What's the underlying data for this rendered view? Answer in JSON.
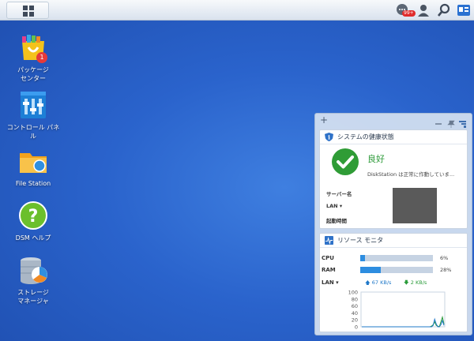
{
  "topbar": {
    "main_menu_icon": "grid-icon",
    "notification_badge": "99+",
    "icons": [
      "chat-icon",
      "user-icon",
      "search-icon",
      "widget-icon"
    ]
  },
  "desktop": {
    "icons": [
      {
        "label": "パッケージ\nセンター",
        "icon": "package-center-icon",
        "badge": "1"
      },
      {
        "label": "コントロール パネル",
        "icon": "control-panel-icon"
      },
      {
        "label": "File Station",
        "icon": "file-station-icon"
      },
      {
        "label": "DSM ヘルプ",
        "icon": "help-icon"
      },
      {
        "label": "ストレージ\nマネージャ",
        "icon": "storage-manager-icon"
      }
    ]
  },
  "widgets": {
    "add_label": "+",
    "health": {
      "title": "システムの健康状態",
      "status": "良好",
      "description": "DiskStation は正常に作動していま...",
      "rows": [
        "サーバー名",
        "LAN ▾",
        "起動時間"
      ]
    },
    "resource": {
      "title": "リソース モニタ",
      "cpu": {
        "label": "CPU",
        "value": 6,
        "text": "6%"
      },
      "ram": {
        "label": "RAM",
        "value": 28,
        "text": "28%"
      },
      "lan": {
        "label": "LAN ▾",
        "up": "67 KB/s",
        "down": "2 KB/s"
      }
    }
  },
  "chart_data": {
    "type": "line",
    "ylim": [
      0,
      100
    ],
    "yticks": [
      "100",
      "80",
      "60",
      "40",
      "20",
      "0"
    ],
    "series": [
      {
        "values": [
          0,
          0,
          0,
          0,
          0,
          0,
          0,
          0,
          0,
          0,
          0,
          0,
          0,
          0,
          0,
          0,
          0,
          0,
          0,
          0,
          0,
          0,
          0,
          0,
          0,
          0,
          0,
          0,
          0,
          0,
          0,
          0,
          0,
          0,
          0,
          0,
          0,
          0,
          0,
          0,
          0,
          0,
          0,
          0,
          0,
          2,
          6,
          14,
          4,
          2,
          0,
          14,
          28,
          8
        ],
        "color": "#2b9c3b"
      },
      {
        "values": [
          0,
          0,
          0,
          0,
          0,
          0,
          0,
          0,
          0,
          0,
          0,
          0,
          0,
          0,
          0,
          0,
          0,
          0,
          0,
          0,
          0,
          0,
          0,
          0,
          0,
          0,
          0,
          0,
          0,
          0,
          0,
          0,
          0,
          0,
          0,
          0,
          0,
          0,
          0,
          0,
          0,
          0,
          0,
          0,
          0,
          0,
          4,
          22,
          8,
          0,
          0,
          6,
          18,
          4
        ],
        "color": "#1f78c8"
      }
    ]
  }
}
